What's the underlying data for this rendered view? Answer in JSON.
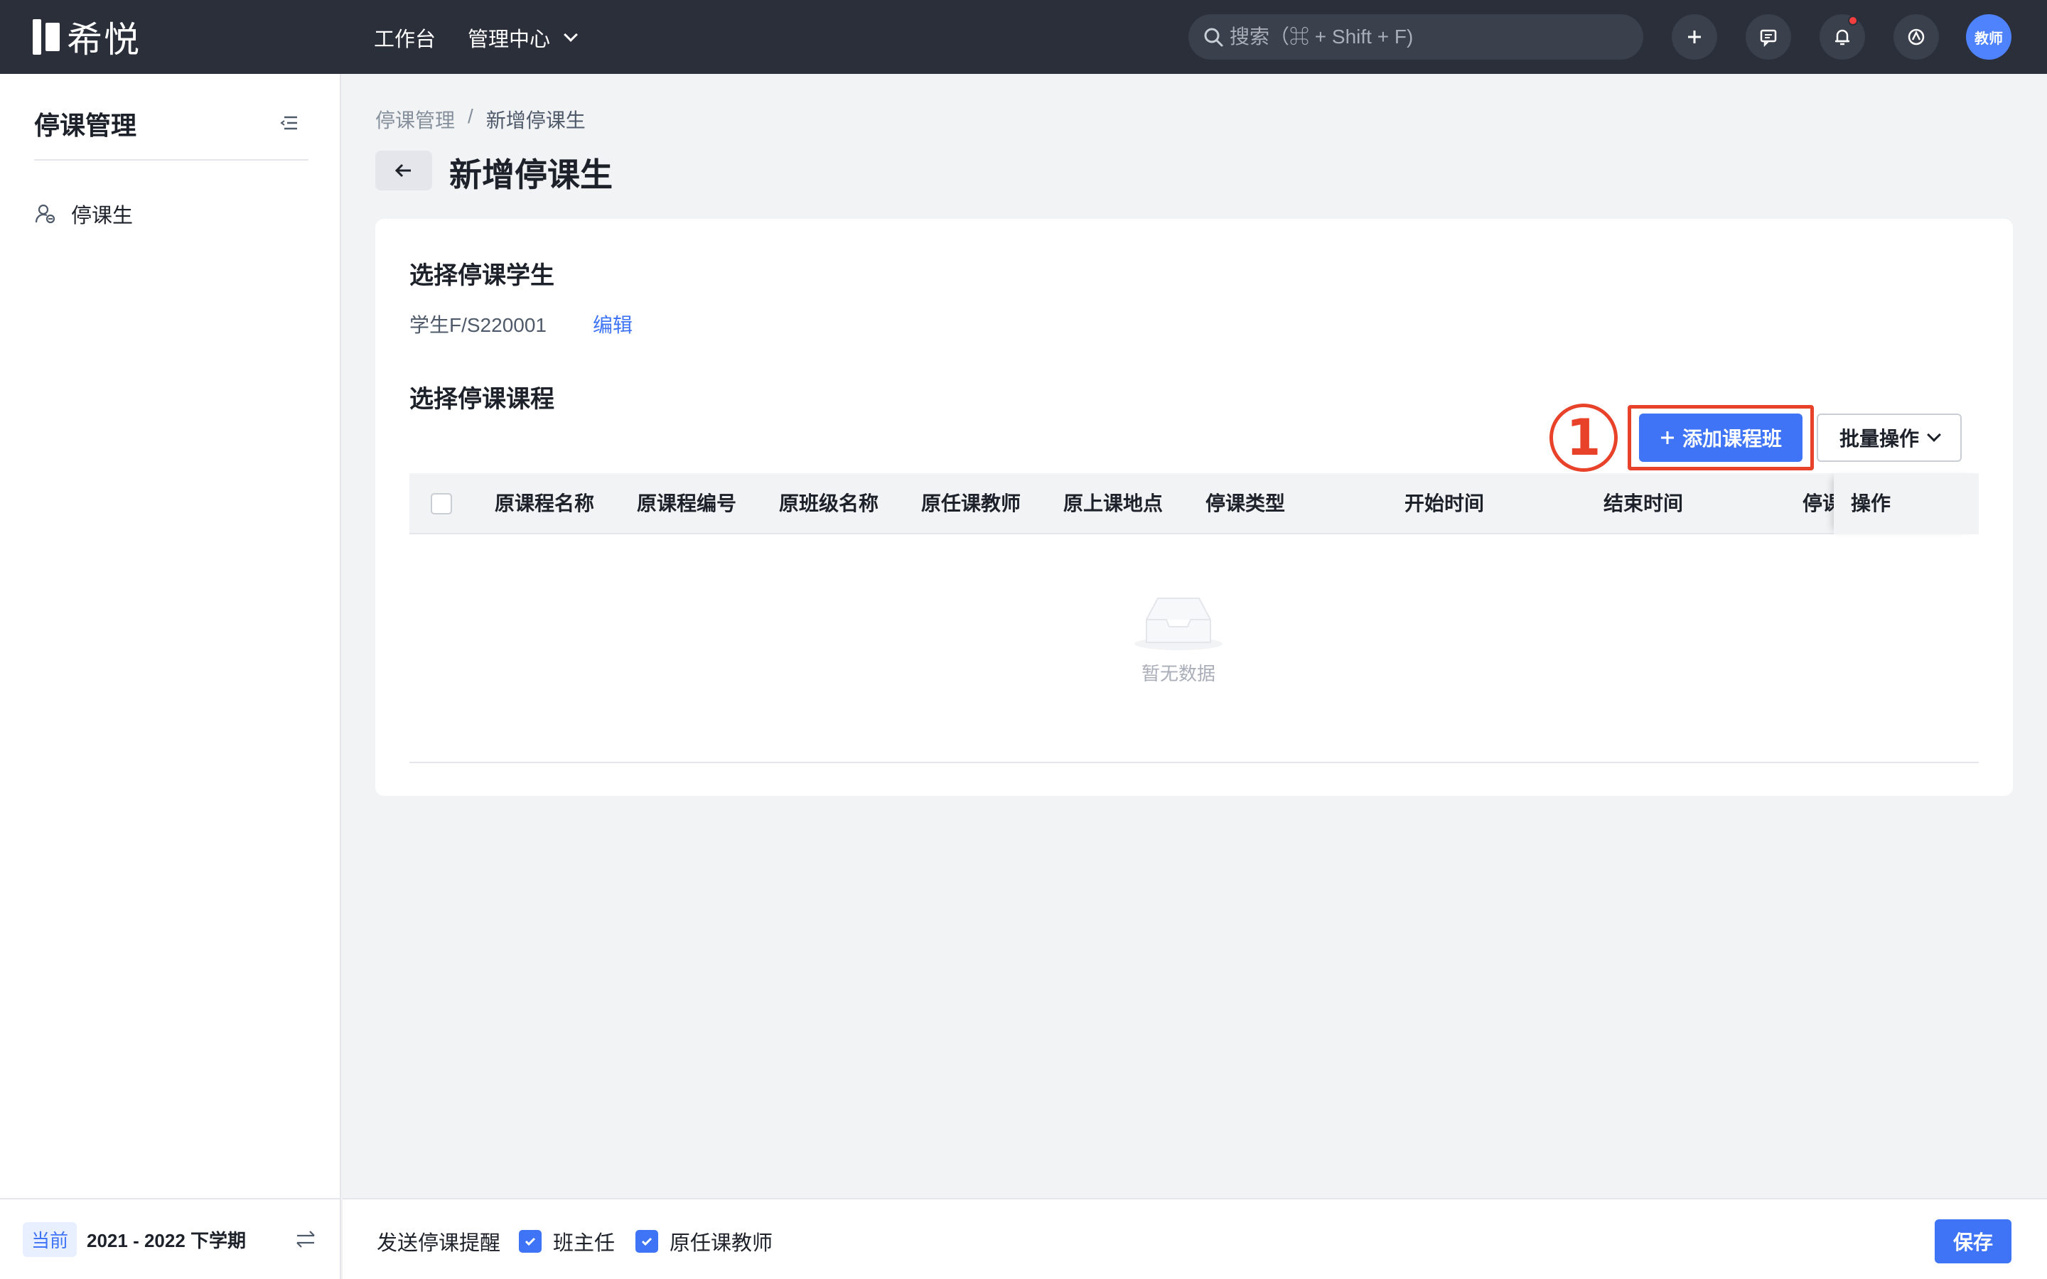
{
  "header": {
    "logo_text": "希悦",
    "nav": {
      "workbench": "工作台",
      "admin_center": "管理中心"
    },
    "search_placeholder": "搜索（⌘ + Shift + F)",
    "avatar_label": "教师"
  },
  "sidebar": {
    "title": "停课管理",
    "items": [
      {
        "label": "停课生",
        "icon": "user-manage-icon"
      }
    ],
    "footer": {
      "badge": "当前",
      "term": "2021 - 2022 下学期"
    }
  },
  "breadcrumb": {
    "parent": "停课管理",
    "separator": "/",
    "current": "新增停课生"
  },
  "page_title": "新增停课生",
  "student_section": {
    "title": "选择停课学生",
    "student": "学生F/S220001",
    "edit_label": "编辑"
  },
  "course_section": {
    "title": "选择停课课程",
    "annotation": "1",
    "add_button": "添加课程班",
    "batch_button": "批量操作",
    "columns": [
      "原课程名称",
      "原课程编号",
      "原班级名称",
      "原任课教师",
      "原上课地点",
      "停课类型",
      "开始时间",
      "结束时间",
      "停课",
      "操作"
    ],
    "empty_text": "暂无数据"
  },
  "footer": {
    "remind_label": "发送停课提醒",
    "options": [
      {
        "label": "班主任",
        "checked": true
      },
      {
        "label": "原任课教师",
        "checked": true
      }
    ],
    "save_label": "保存"
  },
  "colors": {
    "topbar": "#2a2f3a",
    "primary": "#3f74f6",
    "annotation": "#e8432a"
  }
}
